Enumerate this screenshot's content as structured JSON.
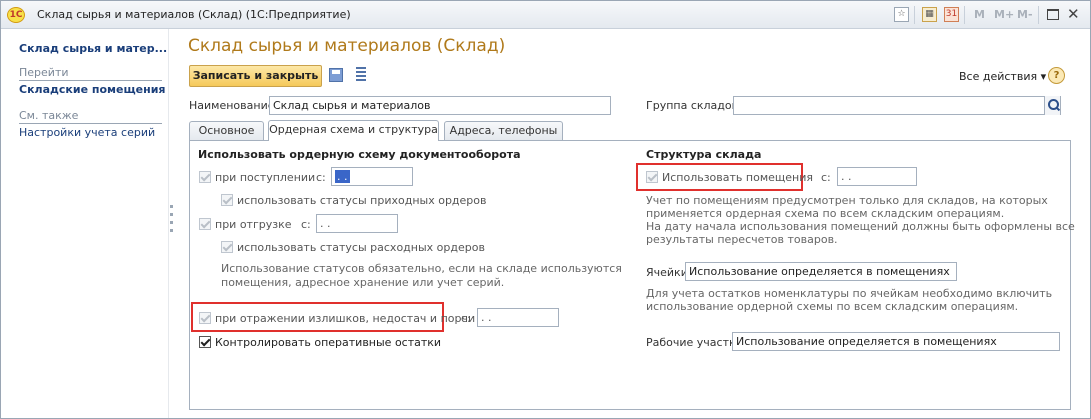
{
  "window": {
    "title": "Склад сырья и материалов (Склад)  (1С:Предприятие)",
    "app_logo": "1С",
    "toolbar_m_buttons": [
      "M",
      "M+",
      "M-"
    ]
  },
  "left_panel": {
    "title": "Склад сырья и матер...",
    "go_header": "Перейти",
    "go_items": [
      "Складские помещения"
    ],
    "see_also_header": "См. также",
    "see_also_items": [
      "Настройки учета серий"
    ]
  },
  "form": {
    "title": "Склад сырья и материалов (Склад)",
    "save_close_label": "Записать и закрыть",
    "all_actions_label": "Все действия ▾",
    "help_label": "?",
    "name_label": "Наименование:",
    "name_value": "Склад сырья и материалов",
    "group_label": "Группа складов:",
    "group_value": ""
  },
  "tabs": [
    {
      "label": "Основное",
      "active": false
    },
    {
      "label": "Ордерная схема и структура",
      "active": true
    },
    {
      "label": "Адреса, телефоны",
      "active": false
    }
  ],
  "order_scheme": {
    "header": "Использовать ордерную схему документооборота",
    "receipt_label": "при поступлении",
    "receipt_date_label": "с:",
    "receipt_date_value": ". .",
    "receipt_statuses_label": "использовать статусы приходных ордеров",
    "shipment_label": "при отгрузке",
    "shipment_date_label": "с:",
    "shipment_date_value": ". .",
    "shipment_statuses_label": "использовать статусы расходных ордеров",
    "statuses_note_1": "Использование статусов обязательно, если на складе используются",
    "statuses_note_2": "помещения, адресное хранение или учет серий.",
    "surplus_label": "при отражении излишков, недостач и порчи",
    "surplus_date_label": "с:",
    "surplus_date_value": ". .",
    "operative_label": "Контролировать оперативные остатки"
  },
  "structure": {
    "header": "Структура склада",
    "use_rooms_label": "Использовать помещения",
    "use_rooms_date_label": "с:",
    "use_rooms_date_value": ". .",
    "rooms_note_1": "Учет по помещениям предусмотрен только для складов, на которых",
    "rooms_note_2": "применяется ордерная схема по всем складским операциям.",
    "rooms_note_3": "На дату начала использования помещений должны быть оформлены все",
    "rooms_note_4": "результаты пересчетов товаров.",
    "cells_label": "Ячейки:",
    "cells_value": "Использование определяется в помещениях",
    "cells_note_1": "Для учета остатков номенклатуры по ячейкам необходимо включить",
    "cells_note_2": "использование ордерной схемы по всем складским операциям.",
    "work_areas_label": "Рабочие участки:",
    "work_areas_value": "Использование определяется в помещениях"
  },
  "colors": {
    "title_accent": "#b07a1b",
    "link": "#1a3e7a",
    "highlight_box": "#e0302d",
    "primary_button": "#f5c95a"
  }
}
